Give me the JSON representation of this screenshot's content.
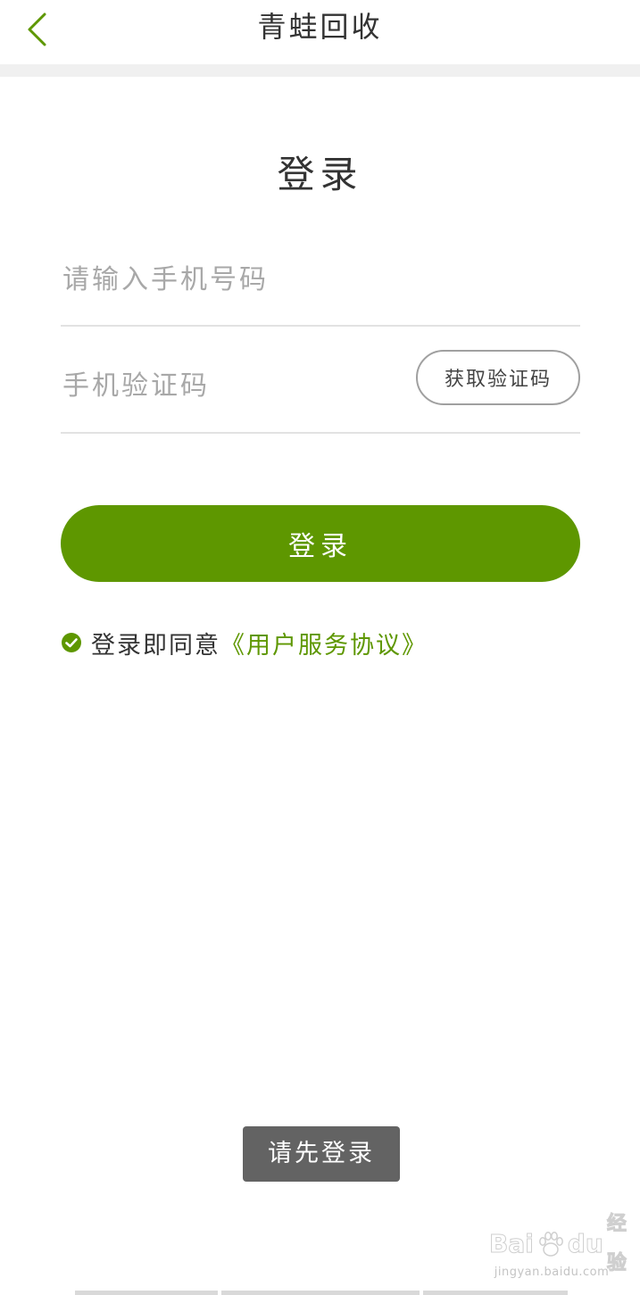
{
  "header": {
    "title": "青蛙回收",
    "back_icon": "chevron-left-icon"
  },
  "login": {
    "title": "登录",
    "phone_placeholder": "请输入手机号码",
    "code_placeholder": "手机验证码",
    "get_code_label": "获取验证码",
    "submit_label": "登录"
  },
  "agreement": {
    "checked": true,
    "text": "登录即同意",
    "link": "《用户服务协议》"
  },
  "toast": {
    "message": "请先登录"
  },
  "watermark": {
    "logo_part1": "Bai",
    "logo_part2": "du",
    "logo_name": "经验",
    "url": "jingyan.baidu.com"
  },
  "colors": {
    "accent": "#5e9700",
    "text": "#333333",
    "placeholder": "#a8a8a8",
    "divider": "#e2e2e2",
    "toast_bg": "#636363"
  }
}
